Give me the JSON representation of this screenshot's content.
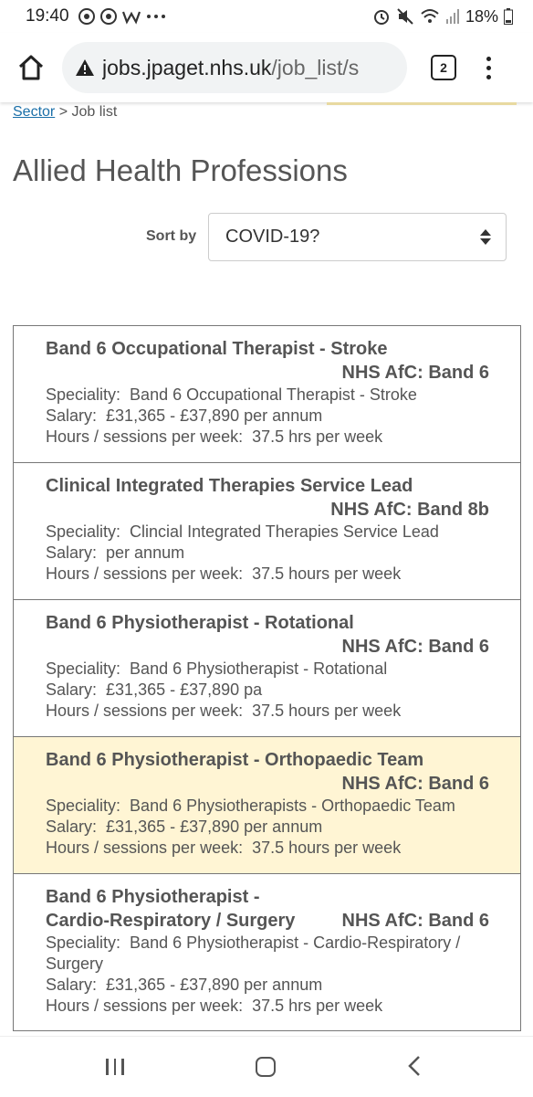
{
  "status_bar": {
    "time": "19:40",
    "battery": "18%",
    "icons": [
      "chrome-icon",
      "chrome-icon",
      "w-app-icon",
      "more-dots-icon",
      "alarm-icon",
      "mute-icon",
      "wifi-icon",
      "signal-icon",
      "battery-icon"
    ]
  },
  "browser": {
    "url_host": "jobs.jpaget.nhs.uk",
    "url_path": "/job_list/s",
    "tab_count": "2"
  },
  "breadcrumb": {
    "link": "Sector",
    "separator": " > ",
    "current": "Job list"
  },
  "page_title": "Allied Health Professions",
  "sort": {
    "label": "Sort by",
    "selected": "COVID-19?"
  },
  "jobs": [
    {
      "title": "Band 6 Occupational Therapist - Stroke",
      "band": "NHS AfC: Band 6",
      "speciality_label": "Speciality:",
      "speciality": "Band 6 Occupational Therapist - Stroke",
      "salary_label": "Salary:",
      "salary": "£31,365 - £37,890 per annum",
      "hours_label": "Hours / sessions per week:",
      "hours": "37.5 hrs per week"
    },
    {
      "title": "Clinical Integrated Therapies Service Lead",
      "band": "NHS AfC: Band 8b",
      "speciality_label": "Speciality:",
      "speciality": "Clincial Integrated Therapies Service Lead",
      "salary_label": "Salary:",
      "salary": "per annum",
      "hours_label": "Hours / sessions per week:",
      "hours": "37.5 hours per week"
    },
    {
      "title": "Band 6 Physiotherapist - Rotational",
      "band": "NHS AfC: Band 6",
      "speciality_label": "Speciality:",
      "speciality": "Band 6 Physiotherapist - Rotational",
      "salary_label": "Salary:",
      "salary": "£31,365 - £37,890 pa",
      "hours_label": "Hours / sessions per week:",
      "hours": "37.5 hours per week"
    },
    {
      "title": "Band 6 Physiotherapist - Orthopaedic Team",
      "band": "NHS AfC: Band 6",
      "speciality_label": "Speciality:",
      "speciality": "Band 6 Physiotherapists - Orthopaedic Team",
      "salary_label": "Salary:",
      "salary": "£31,365 - £37,890 per annum",
      "hours_label": "Hours / sessions per week:",
      "hours": "37.5 hours per week"
    },
    {
      "title": "Band 6 Physiotherapist - Cardio-Respiratory / Surgery",
      "band": "NHS AfC: Band 6",
      "speciality_label": "Speciality:",
      "speciality": "Band 6 Physiotherapist - Cardio-Respiratory / Surgery",
      "salary_label": "Salary:",
      "salary": "£31,365 - £37,890 per annum",
      "hours_label": "Hours / sessions per week:",
      "hours": "37.5 hrs per week"
    }
  ],
  "colors": {
    "link": "#1a6fa8",
    "highlight_row": "#fff5d4",
    "text": "#555555"
  }
}
